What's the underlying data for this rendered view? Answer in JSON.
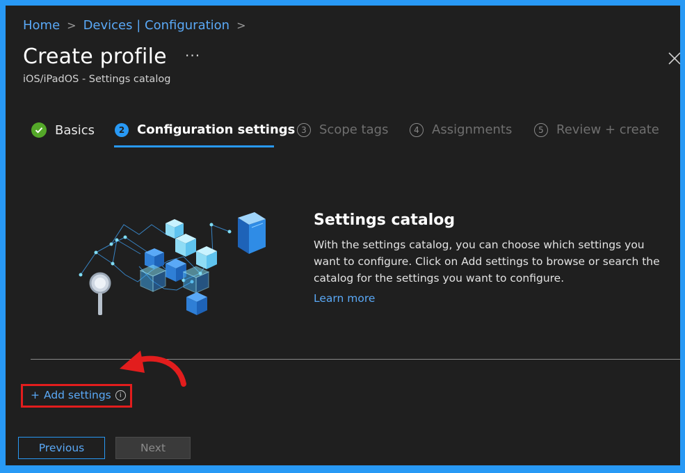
{
  "breadcrumb": {
    "home": "Home",
    "devices": "Devices | Configuration",
    "separator": ">"
  },
  "header": {
    "title": "Create profile",
    "more": "···",
    "subtitle": "iOS/iPadOS - Settings catalog"
  },
  "steps": [
    {
      "number": "✓",
      "label": "Basics",
      "state": "completed"
    },
    {
      "number": "2",
      "label": "Configuration settings",
      "state": "active"
    },
    {
      "number": "3",
      "label": "Scope tags",
      "state": "pending"
    },
    {
      "number": "4",
      "label": "Assignments",
      "state": "pending"
    },
    {
      "number": "5",
      "label": "Review + create",
      "state": "pending"
    }
  ],
  "catalog": {
    "title": "Settings catalog",
    "description": "With the settings catalog, you can choose which settings you want to configure. Click on Add settings to browse or search the catalog for the settings you want to configure.",
    "learn_more": "Learn more"
  },
  "add_settings": {
    "plus": "+",
    "label": "Add settings",
    "info": "i"
  },
  "footer": {
    "previous": "Previous",
    "next": "Next"
  },
  "colors": {
    "background": "#1f1f1f",
    "accent": "#2899f5",
    "link": "#5aa9f7",
    "success": "#54a829",
    "annotation": "#e21d1d"
  }
}
